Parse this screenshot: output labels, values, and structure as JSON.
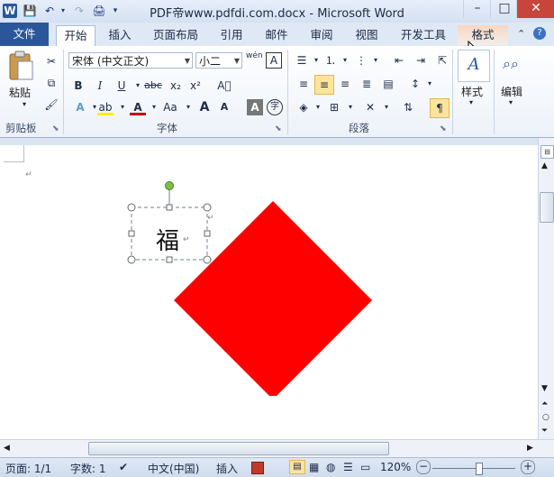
{
  "title_bar": {
    "title": "PDF帝www.pdfdi.com.docx - Microsoft Word",
    "logo": "W",
    "minimize": "–",
    "maximize": "□",
    "close": "✕"
  },
  "tabs": [
    {
      "label": "文件"
    },
    {
      "label": "开始"
    },
    {
      "label": "插入"
    },
    {
      "label": "页面布局"
    },
    {
      "label": "引用"
    },
    {
      "label": "邮件"
    },
    {
      "label": "审阅"
    },
    {
      "label": "视图"
    },
    {
      "label": "开发工具"
    },
    {
      "label": "格式"
    }
  ],
  "ribbon": {
    "clipboard": {
      "paste_label": "粘贴",
      "group_label": "剪贴板"
    },
    "font": {
      "font_name": "宋体 (中文正文)",
      "font_size": "小二",
      "group_label": "字体",
      "bold": "B",
      "italic": "I",
      "underline": "U",
      "strike": "abc",
      "subscript": "x₂",
      "superscript": "x²",
      "phonetic": "wén",
      "border_char": "A",
      "font_color": "A",
      "change_case": "Aa",
      "grow": "A",
      "shrink": "A",
      "enclose": "字"
    },
    "paragraph": {
      "group_label": "段落"
    },
    "styles": {
      "label": "样式"
    },
    "editing": {
      "label": "编辑"
    }
  },
  "document": {
    "text_box_char": "福",
    "shape_color": "#ff0000"
  },
  "status_bar": {
    "page": "页面: 1/1",
    "words": "字数: 1",
    "language": "中文(中国)",
    "insert_mode": "插入",
    "zoom": "120%"
  },
  "colors": {
    "accent": "#2b579a",
    "highlight": "#fde49b"
  }
}
